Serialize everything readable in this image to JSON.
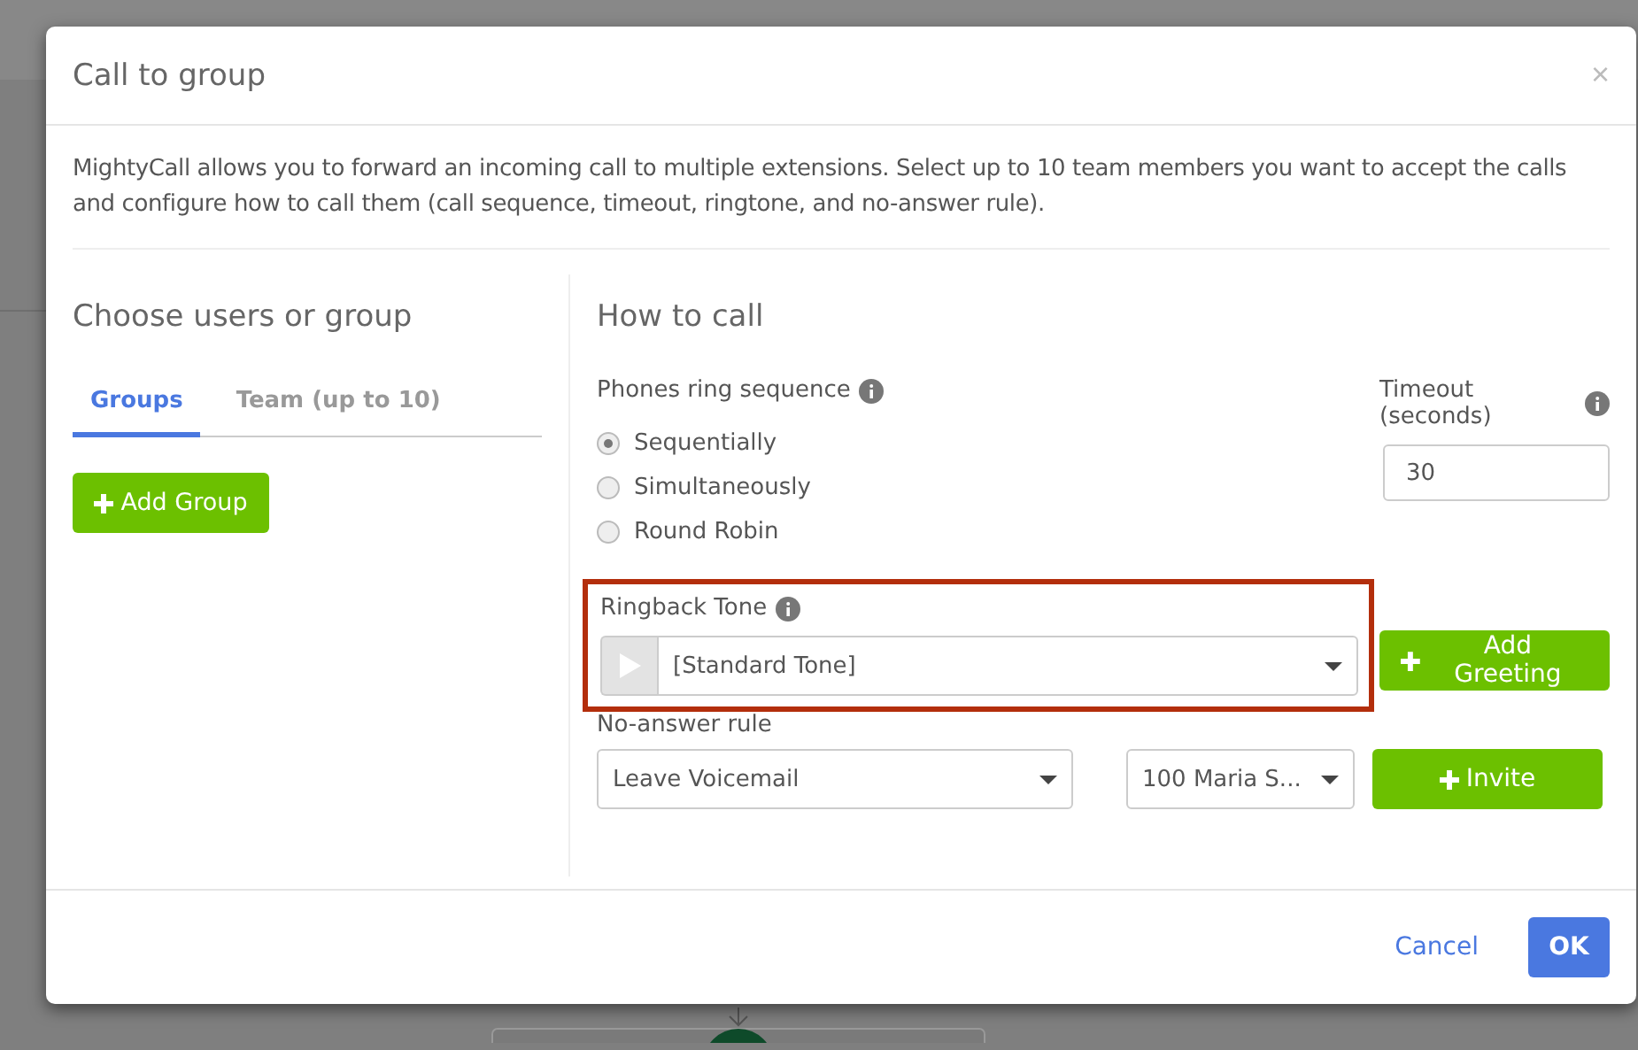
{
  "dialog": {
    "title": "Call to group",
    "close": "×",
    "description": "MightyCall allows you to forward an incoming call to multiple extensions. Select up to 10 team members you want to accept the calls and configure how to call them (call sequence, timeout, ringtone, and no-answer rule)."
  },
  "left": {
    "heading": "Choose users or group",
    "tabs": [
      {
        "label": "Groups",
        "selected": true
      },
      {
        "label": "Team (up to 10)",
        "selected": false
      }
    ],
    "add_button": "Add Group"
  },
  "right": {
    "heading": "How to call",
    "sequence_label": "Phones ring sequence",
    "options": [
      {
        "label": "Sequentially",
        "selected": true
      },
      {
        "label": "Simultaneously",
        "selected": false
      },
      {
        "label": "Round Robin",
        "selected": false
      }
    ],
    "timeout_label": "Timeout (seconds)",
    "timeout_value": "30",
    "ringback": {
      "label": "Ringback Tone",
      "value": "[Standard Tone]",
      "highlighted": true
    },
    "add_greeting": "Add Greeting",
    "no_answer_label": "No-answer rule",
    "no_answer_value": "Leave Voicemail",
    "target_value": "100 Maria S...",
    "invite": "Invite"
  },
  "footer": {
    "cancel": "Cancel",
    "ok": "OK"
  }
}
